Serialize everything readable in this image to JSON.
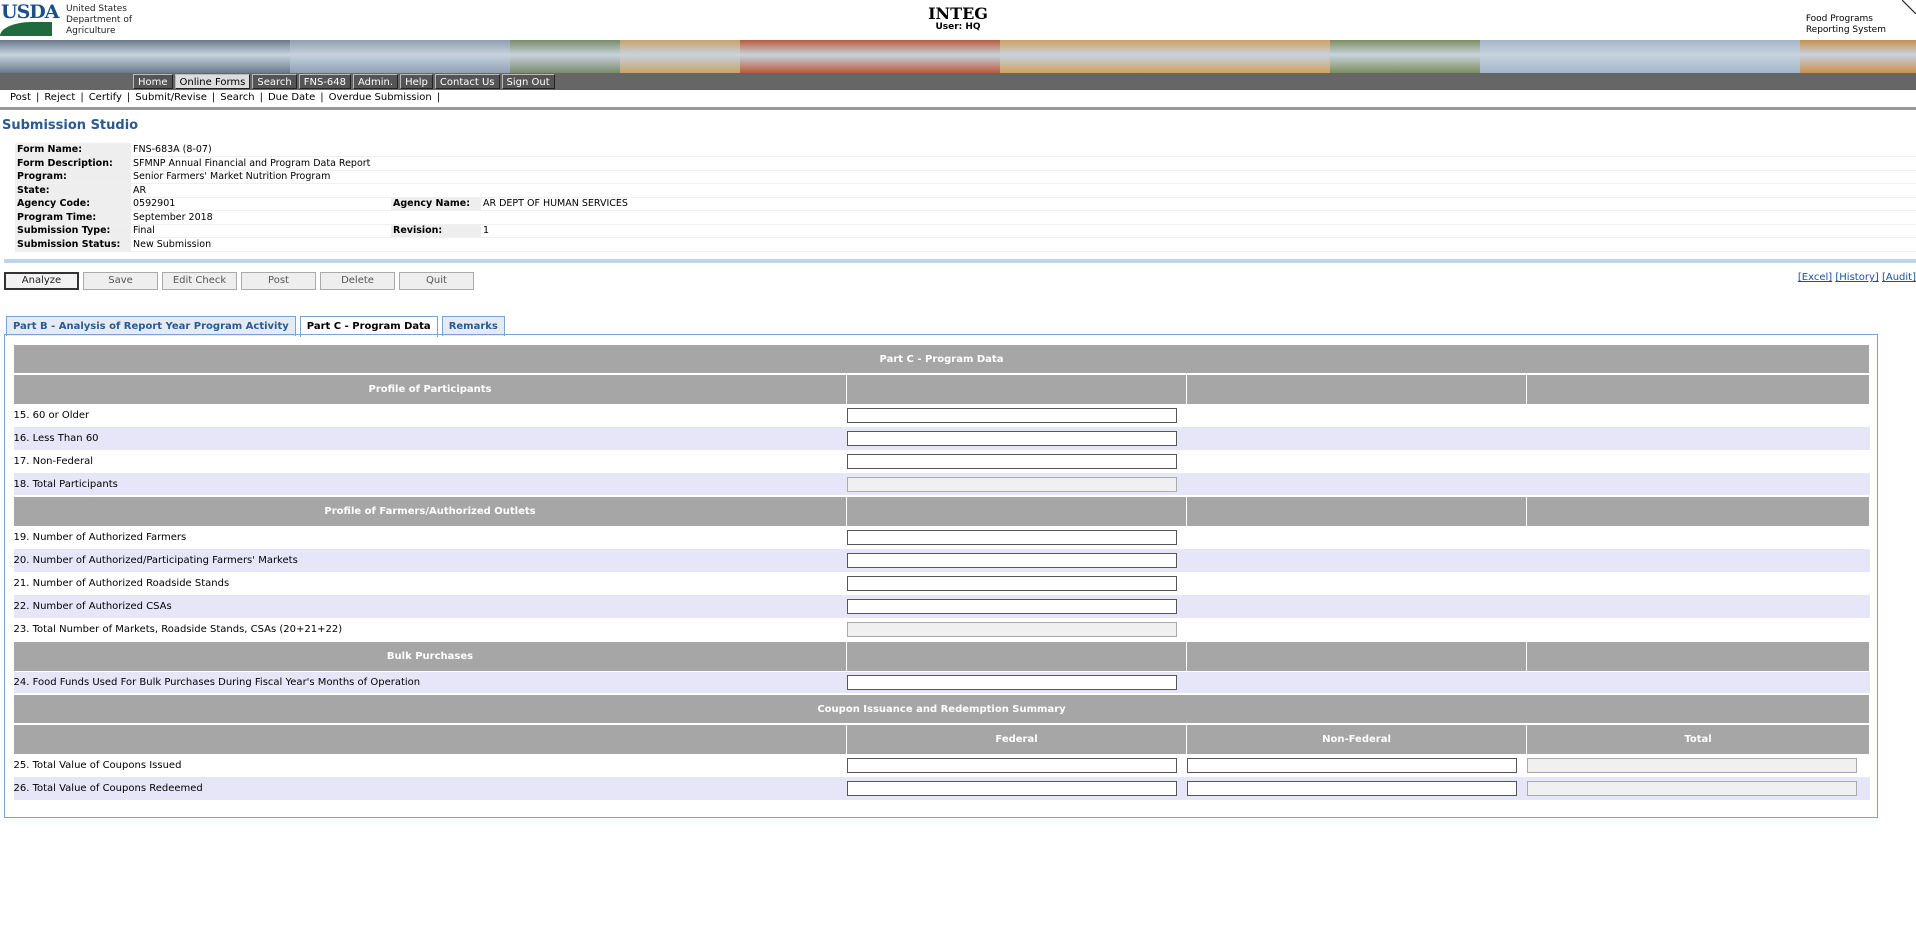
{
  "header": {
    "logo_text": "USDA",
    "org_lines": [
      "United States",
      "Department of",
      "Agriculture"
    ],
    "app_title": "INTEG",
    "user_label": "User: HQ",
    "system_lines": [
      "Food Programs",
      "Reporting System"
    ]
  },
  "banner_colors": [
    "#6a7a8c",
    "#8fa0b0",
    "#7a8a6a",
    "#c9a36b",
    "#b85a3a",
    "#d0a060",
    "#7e8e5e",
    "#a3b6c9",
    "#c98f4f",
    "#5a7a9a"
  ],
  "topnav": [
    {
      "label": "Home",
      "active": false
    },
    {
      "label": "Online Forms",
      "active": true
    },
    {
      "label": "Search",
      "active": false
    },
    {
      "label": "FNS-648",
      "active": false
    },
    {
      "label": "Admin.",
      "active": false
    },
    {
      "label": "Help",
      "active": false
    },
    {
      "label": "Contact Us",
      "active": false
    },
    {
      "label": "Sign Out",
      "active": false
    }
  ],
  "subnav": [
    "Post",
    "Reject",
    "Certify",
    "Submit/Revise",
    "Search",
    "Due Date",
    "Overdue Submission"
  ],
  "page_title": "Submission Studio",
  "info": {
    "form_name_label": "Form Name:",
    "form_name": "FNS-683A (8-07)",
    "form_desc_label": "Form Description:",
    "form_desc": "SFMNP Annual Financial and Program Data Report",
    "program_label": "Program:",
    "program": "Senior Farmers' Market Nutrition Program",
    "state_label": "State:",
    "state": "AR",
    "agency_code_label": "Agency Code:",
    "agency_code": "0592901",
    "agency_name_label": "Agency Name:",
    "agency_name": "AR DEPT OF HUMAN SERVICES",
    "program_time_label": "Program Time:",
    "program_time": "September 2018",
    "submission_type_label": "Submission Type:",
    "submission_type": "Final",
    "revision_label": "Revision:",
    "revision": "1",
    "submission_status_label": "Submission Status:",
    "submission_status": "New Submission"
  },
  "toolbar": {
    "analyze": "Analyze",
    "save": "Save",
    "edit_check": "Edit Check",
    "post": "Post",
    "delete": "Delete",
    "quit": "Quit"
  },
  "links": {
    "excel": "[Excel]",
    "history": "[History]",
    "audit": "[Audit]"
  },
  "tabs": [
    {
      "label": "Part B - Analysis of Report Year Program Activity",
      "active": false
    },
    {
      "label": "Part C - Program Data",
      "active": true
    },
    {
      "label": "Remarks",
      "active": false
    }
  ],
  "grid": {
    "title": "Part C - Program Data",
    "participants_header": "Profile of Participants",
    "r15": "15. 60 or Older",
    "r16": "16. Less Than 60",
    "r17": "17. Non-Federal",
    "r18": "18. Total Participants",
    "farmers_header": "Profile of Farmers/Authorized Outlets",
    "r19": "19. Number of Authorized Farmers",
    "r20": "20. Number of Authorized/Participating Farmers' Markets",
    "r21": "21. Number of Authorized Roadside Stands",
    "r22": "22. Number of Authorized CSAs",
    "r23": "23. Total Number of Markets, Roadside Stands, CSAs (20+21+22)",
    "bulk_header": "Bulk Purchases",
    "r24": "24. Food Funds Used For Bulk Purchases During Fiscal Year's Months of Operation",
    "coupon_header": "Coupon Issuance and Redemption Summary",
    "col_federal": "Federal",
    "col_nonfederal": "Non-Federal",
    "col_total": "Total",
    "r25": "25. Total Value of Coupons Issued",
    "r26": "26. Total Value of Coupons Redeemed"
  }
}
